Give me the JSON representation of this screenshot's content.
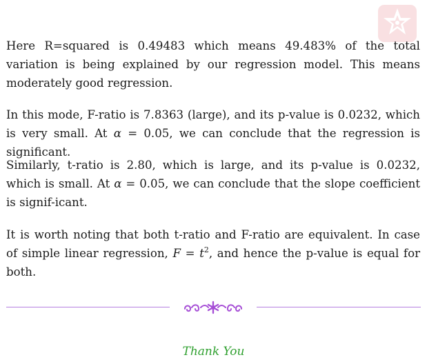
{
  "paragraphs": {
    "p1": {
      "text": "Here R=squared is 0.49483 which means 49.483% of the total variation is being explained by our regression model. This means moderately good regression."
    },
    "p2": {
      "pre": "In this mode, F-ratio is 7.8363 (large), and its p-value is 0.0232, which is very small. At ",
      "alpha": "α",
      "eq": " = 0.05, we can conclude that the regression is significant."
    },
    "p3": {
      "pre": "Similarly, t-ratio is 2.80, which is large, and its p-value is 0.0232, which is small. At ",
      "alpha": "α",
      "eq": " = 0.05, we can conclude that the slope coefficient is signif-icant."
    },
    "p4": {
      "pre": "It is worth noting that both t-ratio and F-ratio are equivalent. In case of simple linear regression, ",
      "F": "F",
      "eq": " = ",
      "t": "t",
      "exp": "2",
      "post": ", and hence the p-value is equal for both."
    }
  },
  "footer": {
    "thanks": "Thank You"
  },
  "colors": {
    "divider": "#b57fe0",
    "ornament": "#a64ed6",
    "thanks": "#2fa02f",
    "logo": "#f7d3d6"
  },
  "icons": {
    "logo": "star-logo-icon",
    "ornament": "floral-ornament-icon"
  }
}
